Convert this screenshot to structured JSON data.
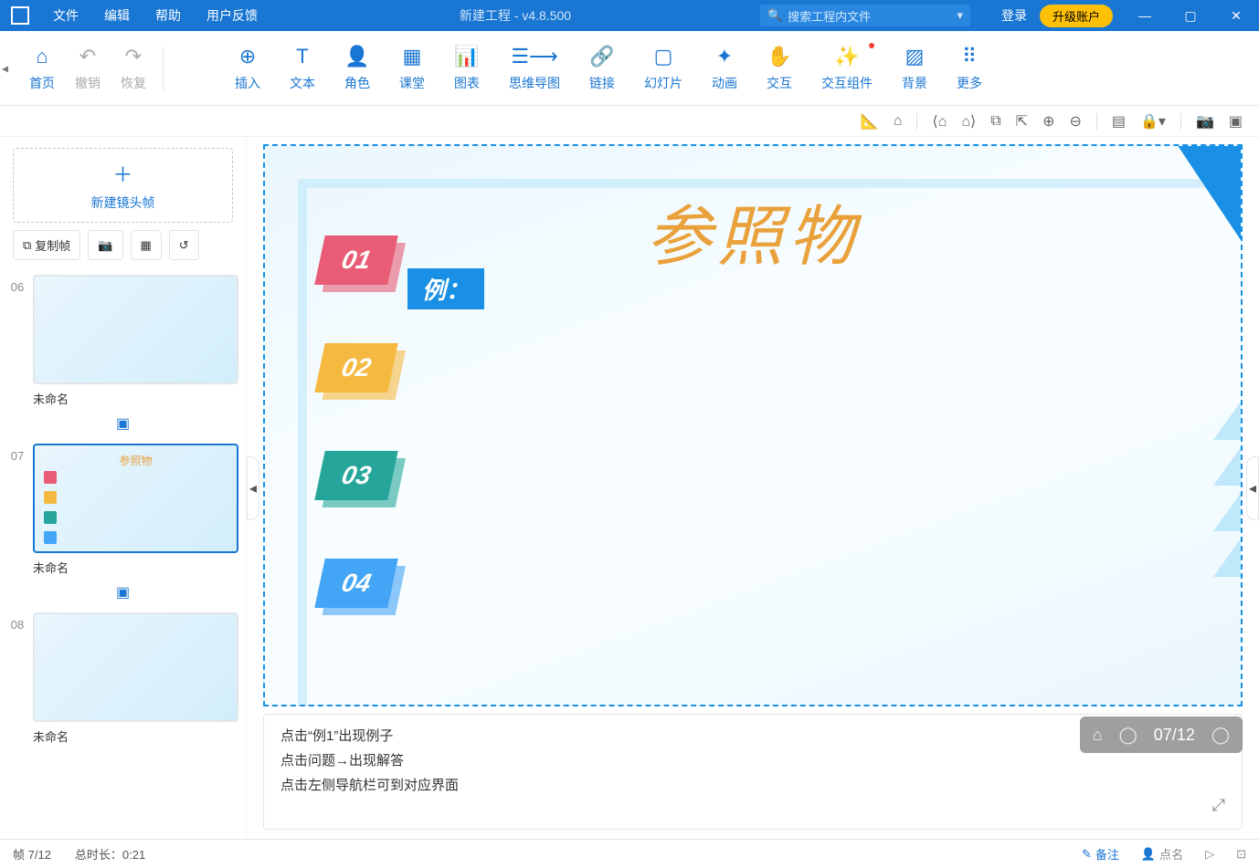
{
  "titlebar": {
    "menus": {
      "file": "文件",
      "edit": "编辑",
      "help": "帮助",
      "feedback": "用户反馈"
    },
    "title": "新建工程 - v4.8.500",
    "search_placeholder": "搜索工程内文件",
    "login": "登录",
    "upgrade": "升级账户"
  },
  "ribbon": {
    "home": "首页",
    "undo": "撤销",
    "redo": "恢复",
    "insert": "插入",
    "text": "文本",
    "role": "角色",
    "class": "课堂",
    "chart": "图表",
    "mindmap": "思维导图",
    "link": "链接",
    "slide": "幻灯片",
    "animation": "动画",
    "interact": "交互",
    "interact_comp": "交互组件",
    "background": "背景",
    "more": "更多"
  },
  "left": {
    "new_frame": "新建镜头帧",
    "copy_frame": "复制帧",
    "thumbs": [
      {
        "num": "06",
        "name": "未命名"
      },
      {
        "num": "07",
        "name": "未命名"
      },
      {
        "num": "08",
        "name": "未命名"
      }
    ]
  },
  "slide": {
    "title": "参照物",
    "example_label": "例：",
    "badges": {
      "b1": "01",
      "b2": "02",
      "b3": "03",
      "b4": "04"
    }
  },
  "page_nav": {
    "label": "07/12"
  },
  "notes": {
    "line1": "点击“例1”出现例子",
    "line2": "点击问题→出现解答",
    "line3": "点击左侧导航栏可到对应界面"
  },
  "statusbar": {
    "frame": "帧 7/12",
    "duration": "总时长：0:21",
    "notes_btn": "备注",
    "roll_call": "点名"
  }
}
